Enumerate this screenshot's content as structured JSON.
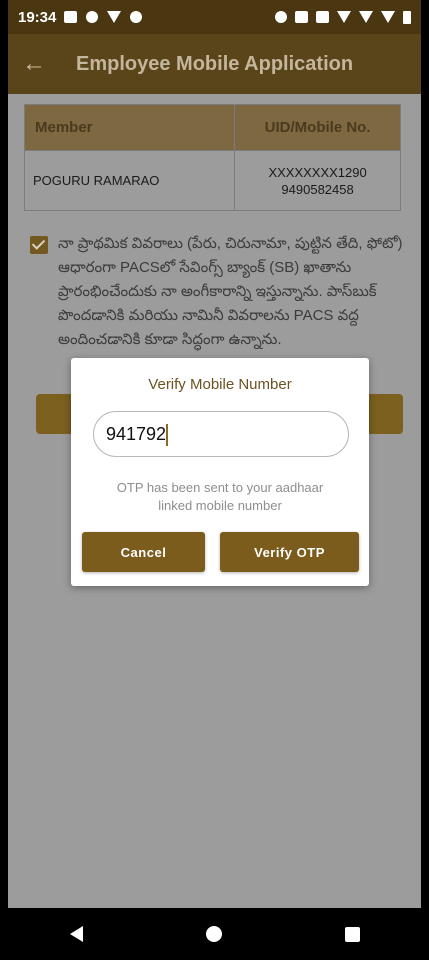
{
  "status_bar": {
    "time": "19:34",
    "left_icons": [
      "notification-icon",
      "cast-icon",
      "play-icon",
      "shield-icon"
    ],
    "right_icons": [
      "mute-icon",
      "sim-icon",
      "sim2-icon",
      "wifi-icon",
      "signal-icon",
      "signal2-icon",
      "battery-icon"
    ]
  },
  "app_bar": {
    "title": "Employee Mobile Application",
    "back_icon": "arrow-left-icon"
  },
  "member_table": {
    "headers": [
      "Member",
      "UID/Mobile No."
    ],
    "rows": [
      {
        "member": "POGURU RAMARAO",
        "uid": "XXXXXXXX1290",
        "mobile": "9490582458"
      }
    ]
  },
  "consent": {
    "checked": true,
    "text": "నా ప్రాథమిక వివరాలు (పేరు, చిరునామా, పుట్టిన తేది, ఫోటో) ఆధారంగా PACSలో సేవింగ్స్ బ్యాంక్ (SB) ఖాతాను ప్రారంభించేందుకు నా అంగీకారాన్ని ఇస్తున్నాను. పాస్‌బుక్ పొందడానికి మరియు నామినీ వివరాలను PACS వద్ద అందించడానికి కూడా సిద్ధంగా ఉన్నాను."
  },
  "dialog": {
    "title": "Verify Mobile Number",
    "input_value": "941792",
    "otp_message": "OTP has been sent to your aadhaar linked mobile number",
    "cancel_label": "Cancel",
    "verify_label": "Verify OTP"
  },
  "colors": {
    "accent": "#7c5c1c",
    "app_bar": "#5a4419",
    "status_bar": "#4a3610"
  }
}
